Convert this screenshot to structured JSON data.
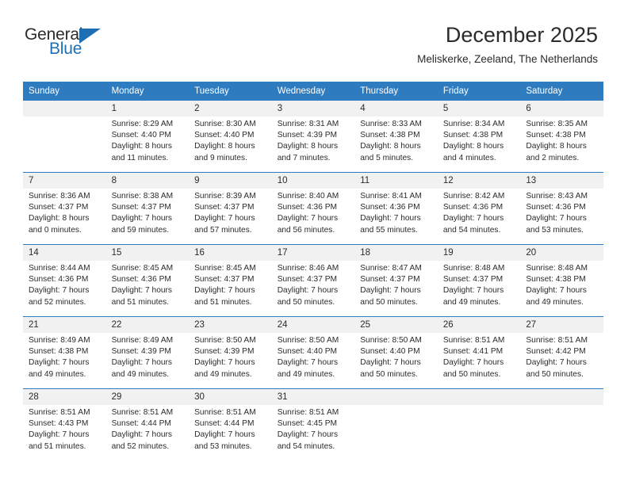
{
  "brand": {
    "name_top": "General",
    "name_bottom": "Blue",
    "color_primary": "#2e7cbf",
    "color_text": "#2b2b2b"
  },
  "header": {
    "title": "December 2025",
    "subtitle": "Meliskerke, Zeeland, The Netherlands"
  },
  "calendar": {
    "weekday_headers": [
      "Sunday",
      "Monday",
      "Tuesday",
      "Wednesday",
      "Thursday",
      "Friday",
      "Saturday"
    ],
    "weeks": [
      [
        {
          "day": "",
          "lines": []
        },
        {
          "day": "1",
          "lines": [
            "Sunrise: 8:29 AM",
            "Sunset: 4:40 PM",
            "Daylight: 8 hours",
            "and 11 minutes."
          ]
        },
        {
          "day": "2",
          "lines": [
            "Sunrise: 8:30 AM",
            "Sunset: 4:40 PM",
            "Daylight: 8 hours",
            "and 9 minutes."
          ]
        },
        {
          "day": "3",
          "lines": [
            "Sunrise: 8:31 AM",
            "Sunset: 4:39 PM",
            "Daylight: 8 hours",
            "and 7 minutes."
          ]
        },
        {
          "day": "4",
          "lines": [
            "Sunrise: 8:33 AM",
            "Sunset: 4:38 PM",
            "Daylight: 8 hours",
            "and 5 minutes."
          ]
        },
        {
          "day": "5",
          "lines": [
            "Sunrise: 8:34 AM",
            "Sunset: 4:38 PM",
            "Daylight: 8 hours",
            "and 4 minutes."
          ]
        },
        {
          "day": "6",
          "lines": [
            "Sunrise: 8:35 AM",
            "Sunset: 4:38 PM",
            "Daylight: 8 hours",
            "and 2 minutes."
          ]
        }
      ],
      [
        {
          "day": "7",
          "lines": [
            "Sunrise: 8:36 AM",
            "Sunset: 4:37 PM",
            "Daylight: 8 hours",
            "and 0 minutes."
          ]
        },
        {
          "day": "8",
          "lines": [
            "Sunrise: 8:38 AM",
            "Sunset: 4:37 PM",
            "Daylight: 7 hours",
            "and 59 minutes."
          ]
        },
        {
          "day": "9",
          "lines": [
            "Sunrise: 8:39 AM",
            "Sunset: 4:37 PM",
            "Daylight: 7 hours",
            "and 57 minutes."
          ]
        },
        {
          "day": "10",
          "lines": [
            "Sunrise: 8:40 AM",
            "Sunset: 4:36 PM",
            "Daylight: 7 hours",
            "and 56 minutes."
          ]
        },
        {
          "day": "11",
          "lines": [
            "Sunrise: 8:41 AM",
            "Sunset: 4:36 PM",
            "Daylight: 7 hours",
            "and 55 minutes."
          ]
        },
        {
          "day": "12",
          "lines": [
            "Sunrise: 8:42 AM",
            "Sunset: 4:36 PM",
            "Daylight: 7 hours",
            "and 54 minutes."
          ]
        },
        {
          "day": "13",
          "lines": [
            "Sunrise: 8:43 AM",
            "Sunset: 4:36 PM",
            "Daylight: 7 hours",
            "and 53 minutes."
          ]
        }
      ],
      [
        {
          "day": "14",
          "lines": [
            "Sunrise: 8:44 AM",
            "Sunset: 4:36 PM",
            "Daylight: 7 hours",
            "and 52 minutes."
          ]
        },
        {
          "day": "15",
          "lines": [
            "Sunrise: 8:45 AM",
            "Sunset: 4:36 PM",
            "Daylight: 7 hours",
            "and 51 minutes."
          ]
        },
        {
          "day": "16",
          "lines": [
            "Sunrise: 8:45 AM",
            "Sunset: 4:37 PM",
            "Daylight: 7 hours",
            "and 51 minutes."
          ]
        },
        {
          "day": "17",
          "lines": [
            "Sunrise: 8:46 AM",
            "Sunset: 4:37 PM",
            "Daylight: 7 hours",
            "and 50 minutes."
          ]
        },
        {
          "day": "18",
          "lines": [
            "Sunrise: 8:47 AM",
            "Sunset: 4:37 PM",
            "Daylight: 7 hours",
            "and 50 minutes."
          ]
        },
        {
          "day": "19",
          "lines": [
            "Sunrise: 8:48 AM",
            "Sunset: 4:37 PM",
            "Daylight: 7 hours",
            "and 49 minutes."
          ]
        },
        {
          "day": "20",
          "lines": [
            "Sunrise: 8:48 AM",
            "Sunset: 4:38 PM",
            "Daylight: 7 hours",
            "and 49 minutes."
          ]
        }
      ],
      [
        {
          "day": "21",
          "lines": [
            "Sunrise: 8:49 AM",
            "Sunset: 4:38 PM",
            "Daylight: 7 hours",
            "and 49 minutes."
          ]
        },
        {
          "day": "22",
          "lines": [
            "Sunrise: 8:49 AM",
            "Sunset: 4:39 PM",
            "Daylight: 7 hours",
            "and 49 minutes."
          ]
        },
        {
          "day": "23",
          "lines": [
            "Sunrise: 8:50 AM",
            "Sunset: 4:39 PM",
            "Daylight: 7 hours",
            "and 49 minutes."
          ]
        },
        {
          "day": "24",
          "lines": [
            "Sunrise: 8:50 AM",
            "Sunset: 4:40 PM",
            "Daylight: 7 hours",
            "and 49 minutes."
          ]
        },
        {
          "day": "25",
          "lines": [
            "Sunrise: 8:50 AM",
            "Sunset: 4:40 PM",
            "Daylight: 7 hours",
            "and 50 minutes."
          ]
        },
        {
          "day": "26",
          "lines": [
            "Sunrise: 8:51 AM",
            "Sunset: 4:41 PM",
            "Daylight: 7 hours",
            "and 50 minutes."
          ]
        },
        {
          "day": "27",
          "lines": [
            "Sunrise: 8:51 AM",
            "Sunset: 4:42 PM",
            "Daylight: 7 hours",
            "and 50 minutes."
          ]
        }
      ],
      [
        {
          "day": "28",
          "lines": [
            "Sunrise: 8:51 AM",
            "Sunset: 4:43 PM",
            "Daylight: 7 hours",
            "and 51 minutes."
          ]
        },
        {
          "day": "29",
          "lines": [
            "Sunrise: 8:51 AM",
            "Sunset: 4:44 PM",
            "Daylight: 7 hours",
            "and 52 minutes."
          ]
        },
        {
          "day": "30",
          "lines": [
            "Sunrise: 8:51 AM",
            "Sunset: 4:44 PM",
            "Daylight: 7 hours",
            "and 53 minutes."
          ]
        },
        {
          "day": "31",
          "lines": [
            "Sunrise: 8:51 AM",
            "Sunset: 4:45 PM",
            "Daylight: 7 hours",
            "and 54 minutes."
          ]
        },
        {
          "day": "",
          "lines": []
        },
        {
          "day": "",
          "lines": []
        },
        {
          "day": "",
          "lines": []
        }
      ]
    ]
  }
}
